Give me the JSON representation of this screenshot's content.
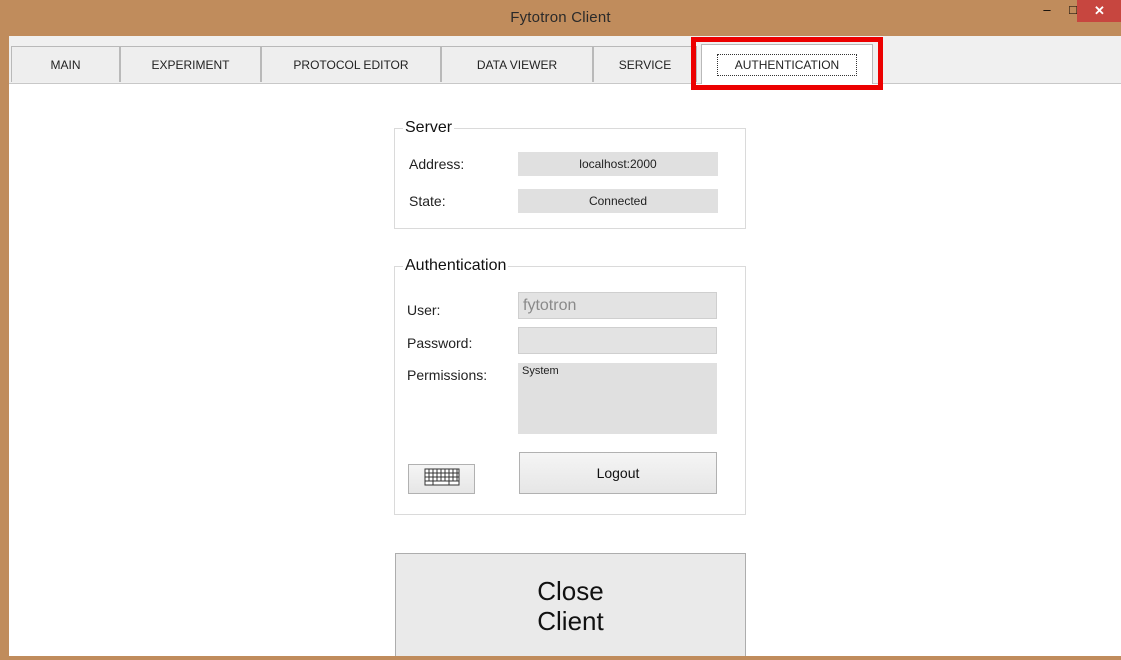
{
  "window": {
    "title": "Fytotron Client",
    "minimize_glyph": "–",
    "maximize_glyph": "□",
    "close_glyph": "✕"
  },
  "tabs": [
    {
      "label": "MAIN"
    },
    {
      "label": "EXPERIMENT"
    },
    {
      "label": "PROTOCOL EDITOR"
    },
    {
      "label": "DATA VIEWER"
    },
    {
      "label": "SERVICE"
    },
    {
      "label": "AUTHENTICATION"
    }
  ],
  "active_tab": "AUTHENTICATION",
  "highlight_color": "#ec0000",
  "server": {
    "title": "Server",
    "address_label": "Address:",
    "address_value": "localhost:2000",
    "state_label": "State:",
    "state_value": "Connected"
  },
  "auth": {
    "title": "Authentication",
    "user_label": "User:",
    "user_value": "fytotron",
    "password_label": "Password:",
    "password_value": "",
    "permissions_label": "Permissions:",
    "permissions_value": "System",
    "keyboard_icon": "keyboard-icon",
    "logout_label": "Logout"
  },
  "close_client": {
    "line1": "Close",
    "line2": "Client"
  }
}
